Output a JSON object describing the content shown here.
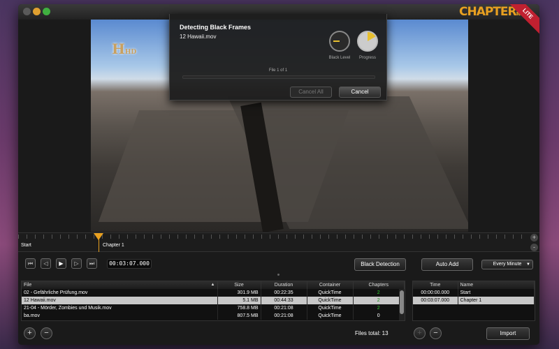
{
  "app": {
    "brand": "CHAPTER",
    "brand_suffix": "it",
    "edition": "LITE"
  },
  "video": {
    "overlay_logo": "H",
    "overlay_logo_suffix": "HD"
  },
  "dialog": {
    "title": "Detecting Black Frames",
    "file": "12 Hawaii.mov",
    "black_level_label": "Black Level",
    "progress_label": "Progress",
    "file_count": "File 1 of 1",
    "cancel_all": "Cancel All",
    "cancel": "Cancel"
  },
  "timeline": {
    "start_label": "Start",
    "chapter1_label": "Chapter 1",
    "plus": "+",
    "minus": "-"
  },
  "transport": {
    "timecode": "00:03:07.000",
    "black_detection": "Black Detection",
    "auto_add": "Auto Add",
    "interval": "Every Minute",
    "icons": [
      "skip-start-icon",
      "step-back-icon",
      "play-icon",
      "step-forward-icon",
      "skip-end-icon"
    ]
  },
  "files": {
    "columns": [
      "File",
      "Size",
      "Duration",
      "Container",
      "Chapters"
    ],
    "rows": [
      {
        "file": "02 - Gefährliche Prüfung.mov",
        "size": "301.9 MB",
        "duration": "00:22:35",
        "container": "QuickTime",
        "chapters": "2"
      },
      {
        "file": "12 Hawaii.mov",
        "size": "5.1 MB",
        "duration": "00:44:33",
        "container": "QuickTime",
        "chapters": "2"
      },
      {
        "file": "21-04 - Mörder, Zombies und Musik.mov",
        "size": "758.8 MB",
        "duration": "00:21:08",
        "container": "QuickTime",
        "chapters": "2"
      },
      {
        "file": "ba.mov",
        "size": "807.5 MB",
        "duration": "00:21:08",
        "container": "QuickTime",
        "chapters": "0"
      }
    ],
    "selected_index": 1,
    "total": "Files total: 13"
  },
  "chapters": {
    "columns": [
      "Time",
      "Name"
    ],
    "rows": [
      {
        "time": "00:00:00.000",
        "name": "Start"
      },
      {
        "time": "00:03:07.000",
        "name": "Chapter 1"
      }
    ],
    "selected_index": 1
  },
  "bottom": {
    "add": "+",
    "remove": "−",
    "import": "Import"
  },
  "colors": {
    "accent": "#e8a020",
    "chapter_count": "#2bd12b",
    "lite_badge": "#c02030"
  }
}
